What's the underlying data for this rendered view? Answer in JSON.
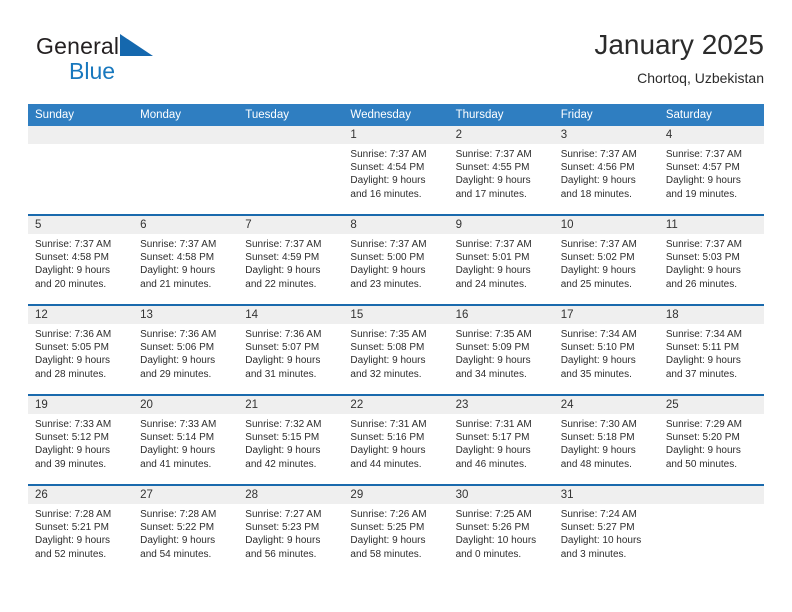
{
  "brand": {
    "word1": "General",
    "word2": "Blue",
    "logo_color": "#1568ae"
  },
  "header": {
    "title": "January 2025",
    "location": "Chortoq, Uzbekistan"
  },
  "theme": {
    "header_blue": "#2f7ec1",
    "divider_blue": "#1a6aad",
    "date_band_gray": "#efefef"
  },
  "weekdays": [
    "Sunday",
    "Monday",
    "Tuesday",
    "Wednesday",
    "Thursday",
    "Friday",
    "Saturday"
  ],
  "weeks": [
    [
      {
        "day": "",
        "sunrise": "",
        "sunset": "",
        "daylight1": "",
        "daylight2": "",
        "empty": true
      },
      {
        "day": "",
        "sunrise": "",
        "sunset": "",
        "daylight1": "",
        "daylight2": "",
        "empty": true
      },
      {
        "day": "",
        "sunrise": "",
        "sunset": "",
        "daylight1": "",
        "daylight2": "",
        "empty": true
      },
      {
        "day": "1",
        "sunrise": "Sunrise: 7:37 AM",
        "sunset": "Sunset: 4:54 PM",
        "daylight1": "Daylight: 9 hours",
        "daylight2": "and 16 minutes."
      },
      {
        "day": "2",
        "sunrise": "Sunrise: 7:37 AM",
        "sunset": "Sunset: 4:55 PM",
        "daylight1": "Daylight: 9 hours",
        "daylight2": "and 17 minutes."
      },
      {
        "day": "3",
        "sunrise": "Sunrise: 7:37 AM",
        "sunset": "Sunset: 4:56 PM",
        "daylight1": "Daylight: 9 hours",
        "daylight2": "and 18 minutes."
      },
      {
        "day": "4",
        "sunrise": "Sunrise: 7:37 AM",
        "sunset": "Sunset: 4:57 PM",
        "daylight1": "Daylight: 9 hours",
        "daylight2": "and 19 minutes."
      }
    ],
    [
      {
        "day": "5",
        "sunrise": "Sunrise: 7:37 AM",
        "sunset": "Sunset: 4:58 PM",
        "daylight1": "Daylight: 9 hours",
        "daylight2": "and 20 minutes."
      },
      {
        "day": "6",
        "sunrise": "Sunrise: 7:37 AM",
        "sunset": "Sunset: 4:58 PM",
        "daylight1": "Daylight: 9 hours",
        "daylight2": "and 21 minutes."
      },
      {
        "day": "7",
        "sunrise": "Sunrise: 7:37 AM",
        "sunset": "Sunset: 4:59 PM",
        "daylight1": "Daylight: 9 hours",
        "daylight2": "and 22 minutes."
      },
      {
        "day": "8",
        "sunrise": "Sunrise: 7:37 AM",
        "sunset": "Sunset: 5:00 PM",
        "daylight1": "Daylight: 9 hours",
        "daylight2": "and 23 minutes."
      },
      {
        "day": "9",
        "sunrise": "Sunrise: 7:37 AM",
        "sunset": "Sunset: 5:01 PM",
        "daylight1": "Daylight: 9 hours",
        "daylight2": "and 24 minutes."
      },
      {
        "day": "10",
        "sunrise": "Sunrise: 7:37 AM",
        "sunset": "Sunset: 5:02 PM",
        "daylight1": "Daylight: 9 hours",
        "daylight2": "and 25 minutes."
      },
      {
        "day": "11",
        "sunrise": "Sunrise: 7:37 AM",
        "sunset": "Sunset: 5:03 PM",
        "daylight1": "Daylight: 9 hours",
        "daylight2": "and 26 minutes."
      }
    ],
    [
      {
        "day": "12",
        "sunrise": "Sunrise: 7:36 AM",
        "sunset": "Sunset: 5:05 PM",
        "daylight1": "Daylight: 9 hours",
        "daylight2": "and 28 minutes."
      },
      {
        "day": "13",
        "sunrise": "Sunrise: 7:36 AM",
        "sunset": "Sunset: 5:06 PM",
        "daylight1": "Daylight: 9 hours",
        "daylight2": "and 29 minutes."
      },
      {
        "day": "14",
        "sunrise": "Sunrise: 7:36 AM",
        "sunset": "Sunset: 5:07 PM",
        "daylight1": "Daylight: 9 hours",
        "daylight2": "and 31 minutes."
      },
      {
        "day": "15",
        "sunrise": "Sunrise: 7:35 AM",
        "sunset": "Sunset: 5:08 PM",
        "daylight1": "Daylight: 9 hours",
        "daylight2": "and 32 minutes."
      },
      {
        "day": "16",
        "sunrise": "Sunrise: 7:35 AM",
        "sunset": "Sunset: 5:09 PM",
        "daylight1": "Daylight: 9 hours",
        "daylight2": "and 34 minutes."
      },
      {
        "day": "17",
        "sunrise": "Sunrise: 7:34 AM",
        "sunset": "Sunset: 5:10 PM",
        "daylight1": "Daylight: 9 hours",
        "daylight2": "and 35 minutes."
      },
      {
        "day": "18",
        "sunrise": "Sunrise: 7:34 AM",
        "sunset": "Sunset: 5:11 PM",
        "daylight1": "Daylight: 9 hours",
        "daylight2": "and 37 minutes."
      }
    ],
    [
      {
        "day": "19",
        "sunrise": "Sunrise: 7:33 AM",
        "sunset": "Sunset: 5:12 PM",
        "daylight1": "Daylight: 9 hours",
        "daylight2": "and 39 minutes."
      },
      {
        "day": "20",
        "sunrise": "Sunrise: 7:33 AM",
        "sunset": "Sunset: 5:14 PM",
        "daylight1": "Daylight: 9 hours",
        "daylight2": "and 41 minutes."
      },
      {
        "day": "21",
        "sunrise": "Sunrise: 7:32 AM",
        "sunset": "Sunset: 5:15 PM",
        "daylight1": "Daylight: 9 hours",
        "daylight2": "and 42 minutes."
      },
      {
        "day": "22",
        "sunrise": "Sunrise: 7:31 AM",
        "sunset": "Sunset: 5:16 PM",
        "daylight1": "Daylight: 9 hours",
        "daylight2": "and 44 minutes."
      },
      {
        "day": "23",
        "sunrise": "Sunrise: 7:31 AM",
        "sunset": "Sunset: 5:17 PM",
        "daylight1": "Daylight: 9 hours",
        "daylight2": "and 46 minutes."
      },
      {
        "day": "24",
        "sunrise": "Sunrise: 7:30 AM",
        "sunset": "Sunset: 5:18 PM",
        "daylight1": "Daylight: 9 hours",
        "daylight2": "and 48 minutes."
      },
      {
        "day": "25",
        "sunrise": "Sunrise: 7:29 AM",
        "sunset": "Sunset: 5:20 PM",
        "daylight1": "Daylight: 9 hours",
        "daylight2": "and 50 minutes."
      }
    ],
    [
      {
        "day": "26",
        "sunrise": "Sunrise: 7:28 AM",
        "sunset": "Sunset: 5:21 PM",
        "daylight1": "Daylight: 9 hours",
        "daylight2": "and 52 minutes."
      },
      {
        "day": "27",
        "sunrise": "Sunrise: 7:28 AM",
        "sunset": "Sunset: 5:22 PM",
        "daylight1": "Daylight: 9 hours",
        "daylight2": "and 54 minutes."
      },
      {
        "day": "28",
        "sunrise": "Sunrise: 7:27 AM",
        "sunset": "Sunset: 5:23 PM",
        "daylight1": "Daylight: 9 hours",
        "daylight2": "and 56 minutes."
      },
      {
        "day": "29",
        "sunrise": "Sunrise: 7:26 AM",
        "sunset": "Sunset: 5:25 PM",
        "daylight1": "Daylight: 9 hours",
        "daylight2": "and 58 minutes."
      },
      {
        "day": "30",
        "sunrise": "Sunrise: 7:25 AM",
        "sunset": "Sunset: 5:26 PM",
        "daylight1": "Daylight: 10 hours",
        "daylight2": "and 0 minutes."
      },
      {
        "day": "31",
        "sunrise": "Sunrise: 7:24 AM",
        "sunset": "Sunset: 5:27 PM",
        "daylight1": "Daylight: 10 hours",
        "daylight2": "and 3 minutes."
      },
      {
        "day": "",
        "sunrise": "",
        "sunset": "",
        "daylight1": "",
        "daylight2": "",
        "empty": true
      }
    ]
  ]
}
